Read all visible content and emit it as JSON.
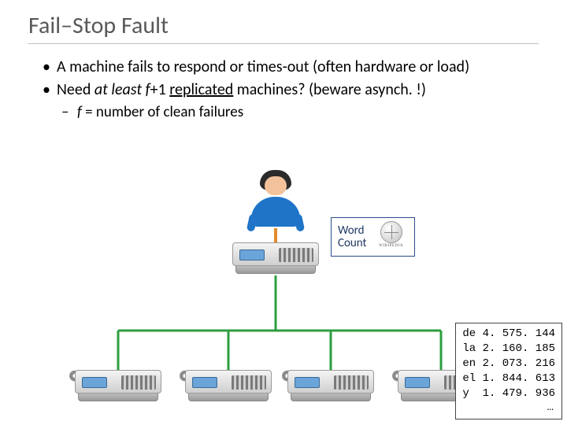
{
  "title": "Fail–Stop Fault",
  "bullets": {
    "b1_pre": "A machine fails to respond or times-out (often hardware or load)",
    "b2_a": "Need ",
    "b2_b": "at least",
    "b2_c": " ",
    "b2_d": "f",
    "b2_e": "+1 ",
    "b2_f": "replicated",
    "b2_g": " machines? (beware asynch. !)",
    "sub_a": "f",
    "sub_b": " = number of clean failures"
  },
  "label": {
    "line1": "Word",
    "line2": "Count",
    "logo_caption": "WIKIPEDIA"
  },
  "results": {
    "rows": [
      {
        "lang": "de",
        "count": "4. 575. 144"
      },
      {
        "lang": "la",
        "count": "2. 160. 185"
      },
      {
        "lang": "en",
        "count": "2. 073. 216"
      },
      {
        "lang": "el",
        "count": "1. 844. 613"
      },
      {
        "lang": "y",
        "count": "1. 479. 936"
      }
    ],
    "ellipsis": "…"
  },
  "icons": {
    "user": "user-avatar",
    "server": "server-icon",
    "gears": "gears-icon",
    "globe": "wikipedia-globe-icon"
  }
}
